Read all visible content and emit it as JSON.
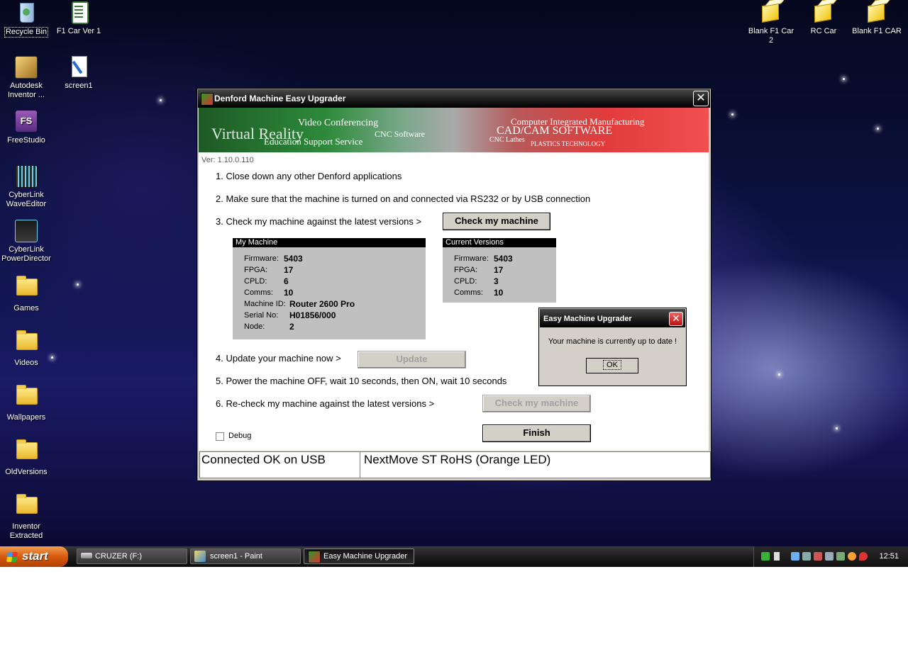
{
  "desktop": {
    "icons_left": [
      {
        "name": "recycle-bin",
        "label": "Recycle Bin"
      },
      {
        "name": "f1-car-ver-1",
        "label": "F1 Car Ver 1"
      },
      {
        "name": "autodesk-inventor",
        "label": "Autodesk Inventor ..."
      },
      {
        "name": "screen1",
        "label": "screen1"
      },
      {
        "name": "freestudio",
        "label": "FreeStudio"
      },
      {
        "name": "cyberlink-waveeditor",
        "label": "CyberLink WaveEditor"
      },
      {
        "name": "cyberlink-powerdirector",
        "label": "CyberLink PowerDirector"
      },
      {
        "name": "games",
        "label": "Games"
      },
      {
        "name": "videos",
        "label": "Videos"
      },
      {
        "name": "wallpapers",
        "label": "Wallpapers"
      },
      {
        "name": "oldversions",
        "label": "OldVersions"
      },
      {
        "name": "inventor-extracted",
        "label": "Inventor Extracted"
      }
    ],
    "icons_right": [
      {
        "name": "blank-f1-car-2",
        "label": "Blank F1 Car 2"
      },
      {
        "name": "rc-car",
        "label": "RC Car"
      },
      {
        "name": "blank-f1-car",
        "label": "Blank F1 CAR"
      }
    ],
    "fs_glyph": "FS"
  },
  "window": {
    "title": "Denford Machine Easy Upgrader",
    "close_glyph": "✕",
    "banner": {
      "t1": "Video Conferencing",
      "t2": "Computer Integrated Manufacturing",
      "t3": "Virtual Reality",
      "t4": "CNC Software",
      "t5": "CAD/CAM SOFTWARE",
      "t6": "Education Support Service",
      "t7": "CNC Lathes",
      "t8": "PLASTICS TECHNOLOGY"
    },
    "version": "Ver: 1.10.0.110",
    "steps": {
      "s1": "1. Close down any other Denford applications",
      "s2": "2. Make sure that the machine is turned on and connected via RS232 or by USB connection",
      "s3": "3. Check my machine against the latest versions >",
      "s4": "4. Update your machine now >",
      "s5": "5. Power the machine OFF, wait 10 seconds, then ON, wait 10 seconds",
      "s6": "6. Re-check my machine against the latest versions >"
    },
    "buttons": {
      "check": "Check my machine",
      "update": "Update",
      "recheck": "Check my machine",
      "finish": "Finish"
    },
    "my_machine": {
      "header": "My Machine",
      "rows": [
        {
          "label": "Firmware:",
          "value": "5403"
        },
        {
          "label": "FPGA:",
          "value": "17"
        },
        {
          "label": "CPLD:",
          "value": "6"
        },
        {
          "label": "Comms:",
          "value": "10"
        },
        {
          "label": "Machine ID:",
          "value": "Router 2600 Pro"
        },
        {
          "label": "Serial No:",
          "value": "H01856/000"
        },
        {
          "label": "Node:",
          "value": "2"
        }
      ]
    },
    "current_versions": {
      "header": "Current Versions",
      "rows": [
        {
          "label": "Firmware:",
          "value": "5403"
        },
        {
          "label": "FPGA:",
          "value": "17"
        },
        {
          "label": "CPLD:",
          "value": "3"
        },
        {
          "label": "Comms:",
          "value": "10"
        }
      ]
    },
    "debug_label": "Debug",
    "status_left": "Connected OK on USB",
    "status_right": "NextMove ST RoHS (Orange LED)"
  },
  "dialog": {
    "title": "Easy Machine Upgrader",
    "close_glyph": "✕",
    "message": "Your machine is currently up to date !",
    "ok": "OK"
  },
  "taskbar": {
    "start": "start",
    "items": [
      {
        "name": "cruzer",
        "label": "CRUZER (F:)"
      },
      {
        "name": "paint",
        "label": "screen1 - Paint"
      },
      {
        "name": "easy-machine-upgrader",
        "label": "Easy Machine Upgrader"
      }
    ],
    "clock": "12:51"
  }
}
